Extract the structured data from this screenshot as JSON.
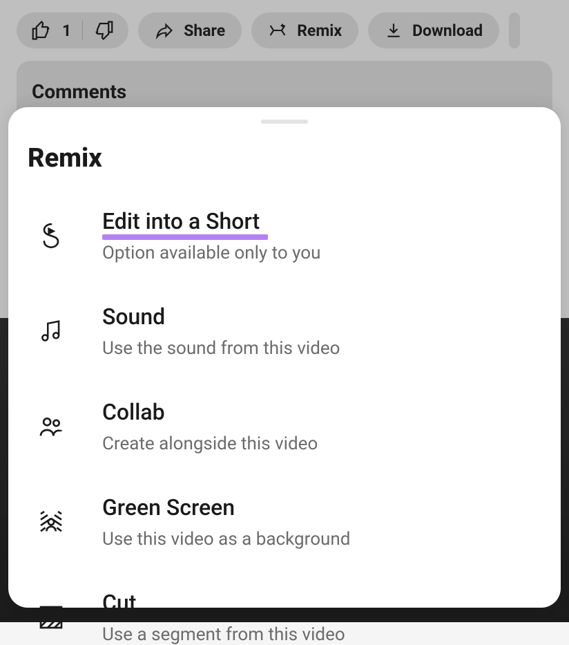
{
  "actionBar": {
    "likeCount": "1",
    "share": "Share",
    "remix": "Remix",
    "download": "Download"
  },
  "comments": {
    "title": "Comments"
  },
  "sheet": {
    "title": "Remix",
    "options": [
      {
        "icon": "remix-icon",
        "title": "Edit into a Short",
        "subtitle": "Option available only to you",
        "highlighted": true
      },
      {
        "icon": "music-icon",
        "title": "Sound",
        "subtitle": "Use the sound from this video",
        "highlighted": false
      },
      {
        "icon": "collab-icon",
        "title": "Collab",
        "subtitle": "Create alongside this video",
        "highlighted": false
      },
      {
        "icon": "greenscreen-icon",
        "title": "Green Screen",
        "subtitle": "Use this video as a background",
        "highlighted": false
      },
      {
        "icon": "cut-icon",
        "title": "Cut",
        "subtitle": "Use a segment from this video",
        "highlighted": false
      }
    ]
  }
}
